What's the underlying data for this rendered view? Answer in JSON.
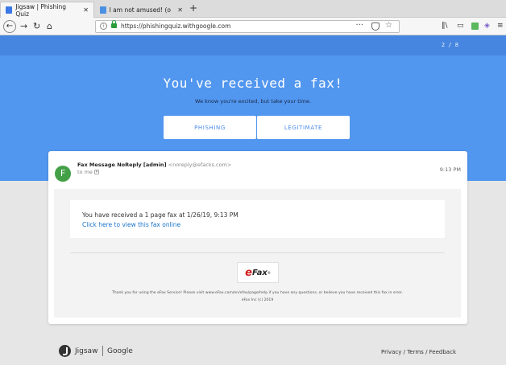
{
  "browser": {
    "tabs": [
      {
        "title": "Jigsaw | Phishing Quiz",
        "active": true,
        "favicon_color": "#3b78e7"
      },
      {
        "title": "I am not amused! (or ho",
        "active": false,
        "favicon_color": "#4a90e2"
      }
    ],
    "url": "https://phishingquiz.withgoogle.com",
    "url_menu": "···"
  },
  "quiz": {
    "progress": "2 / 8",
    "heading": "You've received a fax!",
    "subheading": "We know you're excited, but take your time.",
    "phishing_label": "PHISHING",
    "legitimate_label": "LEGITIMATE"
  },
  "email": {
    "avatar_letter": "F",
    "avatar_color": "#43a047",
    "sender_name": "Fax Message NoReply [admin]",
    "sender_email": "<noreply@efacks.com>",
    "to": "to me",
    "time": "9:13 PM",
    "message_line": "You have received a 1 page fax at 1/26/19, 9:13 PM",
    "message_link": "Click here to view this fax online",
    "logo_e": "e",
    "logo_fax": "Fax",
    "logo_tm": "®",
    "footer_line1": "Thank you for using the eFax Service! Please visit www.eFax.com/en/efax/page/help if you have any questions, or believe you have received this fax in error.",
    "footer_line2": "eFax Inc (c) 2019"
  },
  "footer": {
    "jigsaw": "Jigsaw",
    "google": "Google",
    "privacy": "Privacy",
    "terms": "Terms",
    "feedback": "Feedback",
    "divider": "/"
  },
  "colors": {
    "hero": "#5196ef",
    "accent": "#4a8bea",
    "link": "#1a73c8"
  }
}
